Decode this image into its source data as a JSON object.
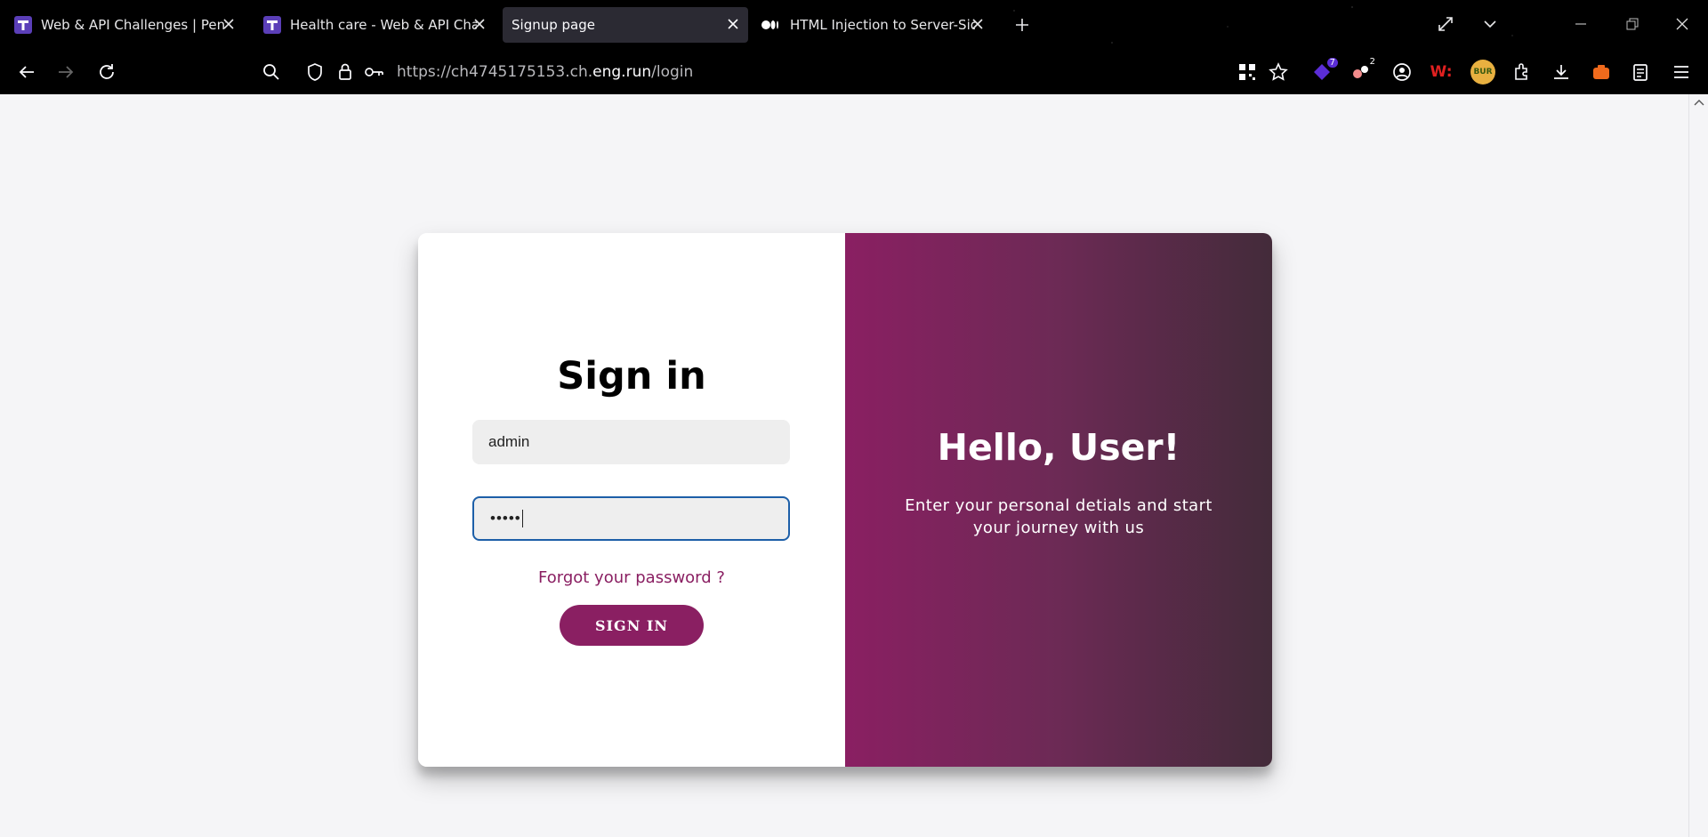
{
  "tabs": [
    {
      "title": "Web & API Challenges | Pentath",
      "active": false
    },
    {
      "title": "Health care - Web & API Challe",
      "active": false
    },
    {
      "title": "Signup page",
      "active": true
    },
    {
      "title": "HTML Injection to Server-Side R",
      "active": false
    }
  ],
  "address": {
    "prefix": "https://ch4745175153.ch.",
    "host": "eng.run",
    "path": "/login"
  },
  "toolbar": {
    "extension_badge_1": "7",
    "extension_badge_2": "2",
    "extension_badge_3": "W:",
    "extension_badge_4": "BUR"
  },
  "signin": {
    "title": "Sign in",
    "username_value": "admin",
    "password_mask": "•••••",
    "forgot_label": "Forgot your password ?",
    "button_label": "SIGN IN"
  },
  "overlay": {
    "title": "Hello, User!",
    "text": "Enter your personal detials and start your journey with us"
  },
  "colors": {
    "accent": "#8a1f62",
    "gradient_start": "#8a1f62",
    "gradient_end": "#432b3a",
    "focus_border": "#1d5fa8"
  }
}
